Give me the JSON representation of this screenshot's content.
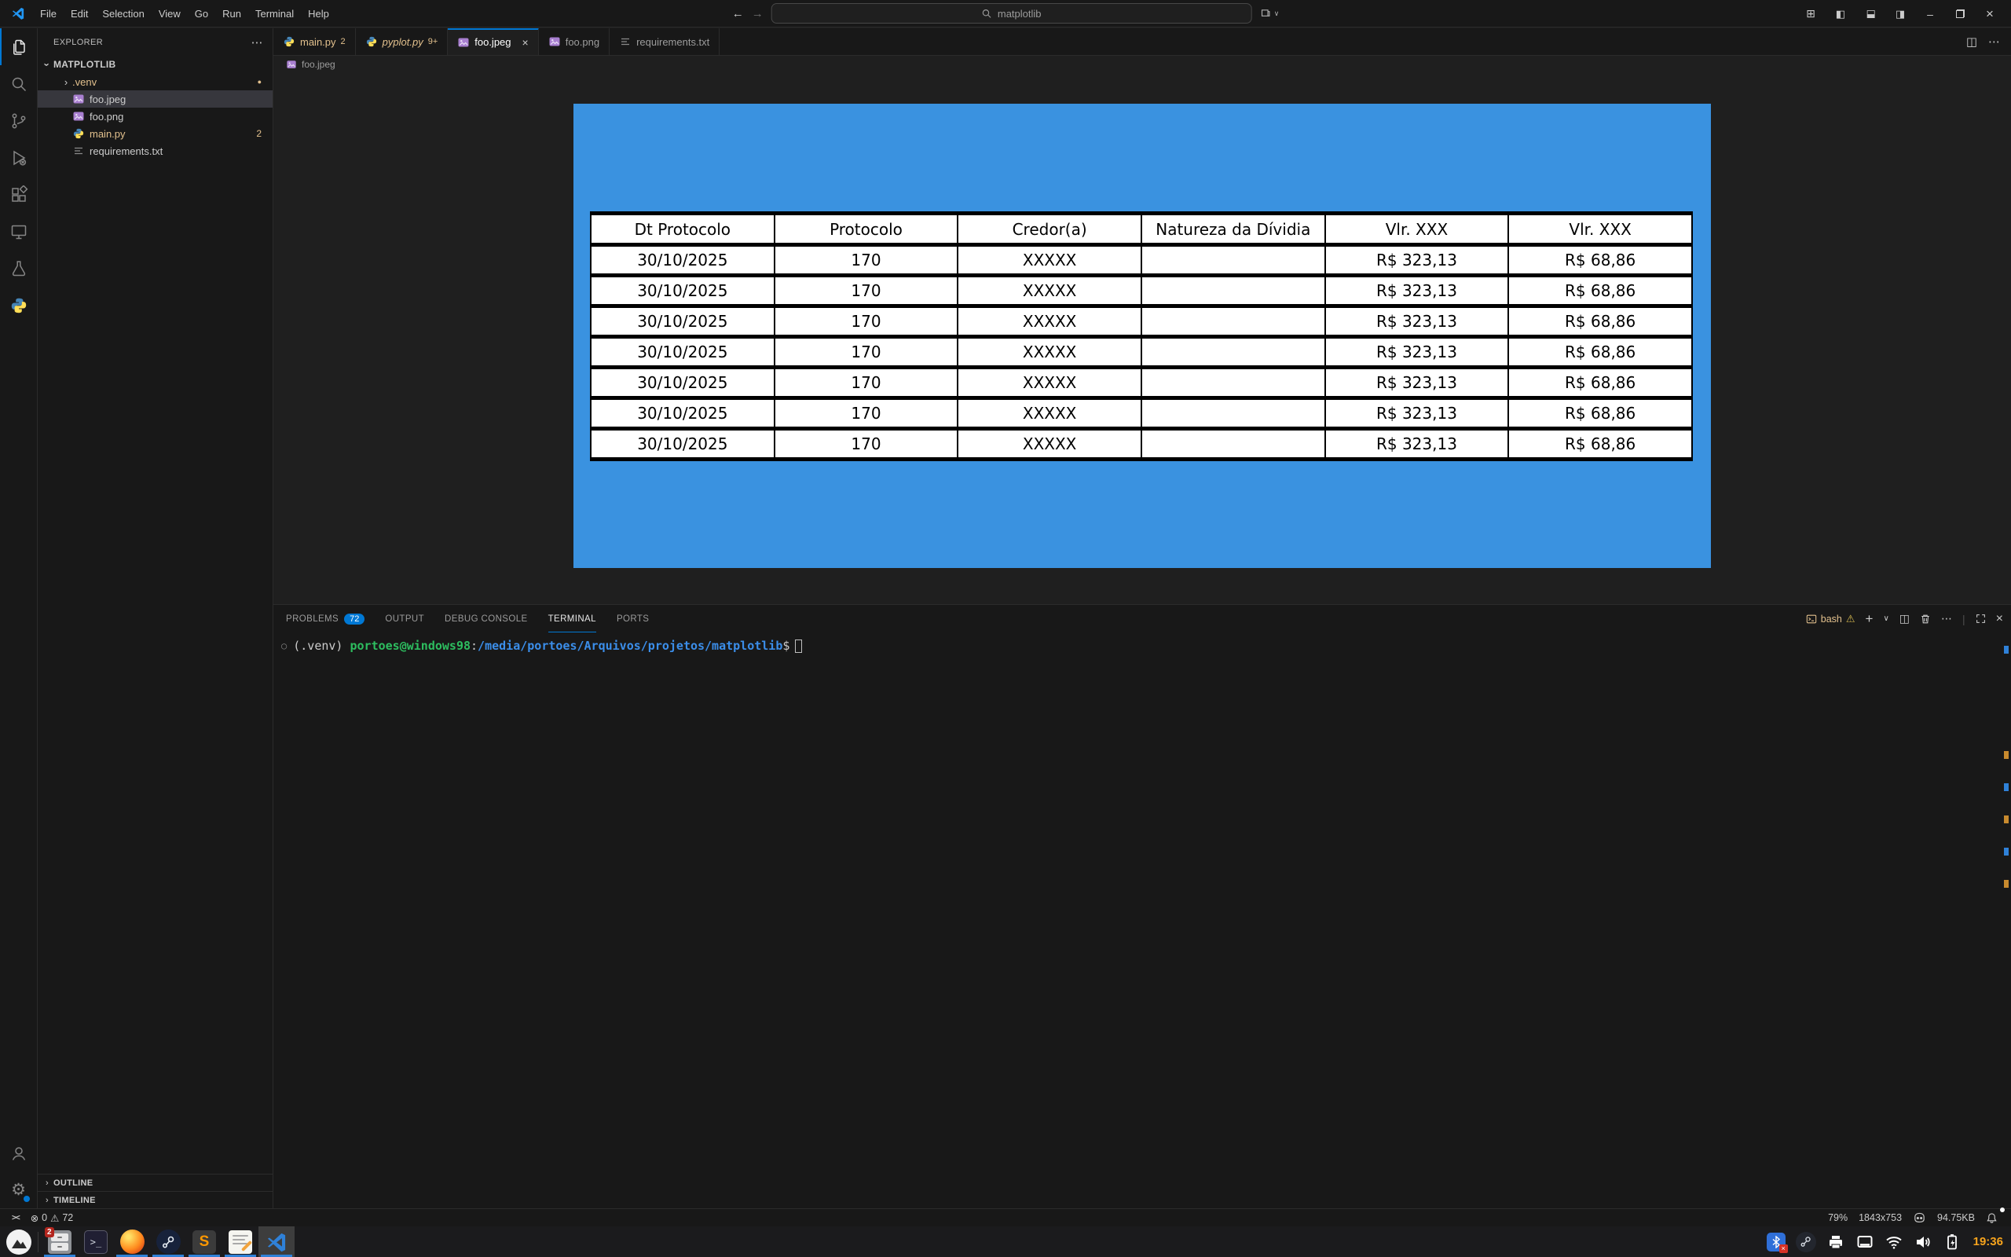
{
  "titlebar": {
    "menus": [
      "File",
      "Edit",
      "Selection",
      "View",
      "Go",
      "Run",
      "Terminal",
      "Help"
    ],
    "command_center": "matplotlib",
    "icons": {
      "back": "←",
      "forward": "→",
      "customize_layout": "⊞",
      "toggle_sidebar": "◧",
      "toggle_panel": "◧",
      "toggle_secondary": "◨",
      "minimize": "–",
      "close": "×",
      "layout_dropdown": "∨"
    }
  },
  "activity_bar": {
    "items": [
      "explorer",
      "search",
      "source-control",
      "run-and-debug",
      "extensions",
      "remote-explorer",
      "testing",
      "python"
    ],
    "bottom": [
      "accounts",
      "settings"
    ],
    "gear_glyph": "⚙"
  },
  "sidebar": {
    "header": "EXPLORER",
    "header_more": "⋯",
    "chevron": "›",
    "root": "MATPLOTLIB",
    "items": [
      {
        "label": ".venv",
        "badge": "●"
      },
      {
        "label": "foo.jpeg",
        "badge": ""
      },
      {
        "label": "foo.png",
        "badge": ""
      },
      {
        "label": "main.py",
        "badge": "2"
      },
      {
        "label": "requirements.txt",
        "badge": ""
      }
    ],
    "outline": "OUTLINE",
    "timeline": "TIMELINE"
  },
  "editor": {
    "tabs": [
      {
        "label": "main.py",
        "badge": "2"
      },
      {
        "label": "pyplot.py",
        "badge": "9+"
      },
      {
        "label": "foo.jpeg",
        "badge": ""
      },
      {
        "label": "foo.png",
        "badge": ""
      },
      {
        "label": "requirements.txt",
        "badge": ""
      }
    ],
    "tab_close": "×",
    "actions": {
      "split": "◫",
      "more": "⋯"
    },
    "breadcrumb": "foo.jpeg",
    "image": {
      "background_color": "#3a92e0",
      "table": {
        "headers": [
          "Dt Protocolo",
          "Protocolo",
          "Credor(a)",
          "Natureza da Dívidia",
          "Vlr. XXX",
          "Vlr. XXX"
        ],
        "rows": [
          [
            "30/10/2025",
            "170",
            "XXXXX",
            "",
            "R$ 323,13",
            "R$ 68,86"
          ],
          [
            "30/10/2025",
            "170",
            "XXXXX",
            "",
            "R$ 323,13",
            "R$ 68,86"
          ],
          [
            "30/10/2025",
            "170",
            "XXXXX",
            "",
            "R$ 323,13",
            "R$ 68,86"
          ],
          [
            "30/10/2025",
            "170",
            "XXXXX",
            "",
            "R$ 323,13",
            "R$ 68,86"
          ],
          [
            "30/10/2025",
            "170",
            "XXXXX",
            "",
            "R$ 323,13",
            "R$ 68,86"
          ],
          [
            "30/10/2025",
            "170",
            "XXXXX",
            "",
            "R$ 323,13",
            "R$ 68,86"
          ],
          [
            "30/10/2025",
            "170",
            "XXXXX",
            "",
            "R$ 323,13",
            "R$ 68,86"
          ]
        ]
      }
    }
  },
  "panel": {
    "tabs": [
      {
        "label": "PROBLEMS",
        "badge": "72"
      },
      {
        "label": "OUTPUT",
        "badge": ""
      },
      {
        "label": "DEBUG CONSOLE",
        "badge": ""
      },
      {
        "label": "TERMINAL",
        "badge": ""
      },
      {
        "label": "PORTS",
        "badge": ""
      }
    ],
    "shell": "bash",
    "icons": {
      "warning": "⚠",
      "new": "+",
      "dropdown": "∨",
      "split": "◫",
      "more": "⋯",
      "separator": "|",
      "close": "×"
    },
    "terminal": {
      "decoration": "○",
      "venv": "(.venv)",
      "user": "portoes@windows98",
      "colon": ":",
      "path": "/media/portoes/Arquivos/projetos/matplotlib",
      "prompt": "$"
    }
  },
  "status_bar": {
    "remote_glyph": "><",
    "error_icon": "⊗",
    "errors": "0",
    "warning_icon": "⚠",
    "warnings": "72",
    "zoom": "79%",
    "dimensions": "1843x753",
    "file_size": "94.75KB"
  },
  "taskbar": {
    "apps": [
      "app-menu",
      "file-manager",
      "terminal",
      "firefox",
      "steam",
      "sublime-text",
      "text-editor",
      "vscode"
    ],
    "file_manager_badge": "2",
    "terminal_glyph": ">_",
    "sublime_glyph": "S",
    "clock": "19:36"
  }
}
